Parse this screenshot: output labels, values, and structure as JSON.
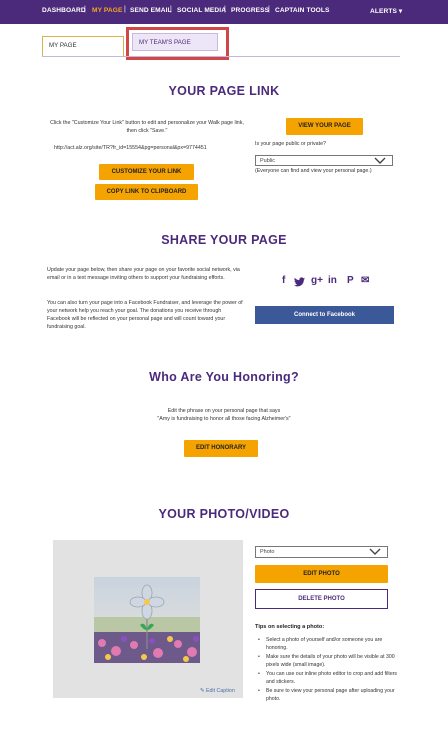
{
  "nav": {
    "items": [
      {
        "label": "DASHBOARD",
        "active": false
      },
      {
        "label": "MY PAGE",
        "active": true
      },
      {
        "label": "SEND EMAIL",
        "active": false
      },
      {
        "label": "SOCIAL MEDIA",
        "active": false
      },
      {
        "label": "PROGRESS",
        "active": false
      },
      {
        "label": "CAPTAIN TOOLS",
        "active": false
      }
    ],
    "alerts_label": "ALERTS",
    "alerts_caret": "▾",
    "separator": "|"
  },
  "tabs": {
    "my_page": "MY PAGE",
    "team_page": "MY TEAM'S PAGE"
  },
  "page_link": {
    "title": "YOUR PAGE LINK",
    "instructions": "Click the \"Customize Your Link\" button to edit and personalize your Walk page link, then click \"Save.\"",
    "url": "http://act.alz.org/site/TR?fr_id=15554&pg=personal&px=9774451",
    "customize_button": "CUSTOMIZE YOUR LINK",
    "copy_button": "COPY LINK TO CLIPBOARD",
    "view_button": "VIEW YOUR PAGE",
    "privacy_question": "Is your page public or private?",
    "privacy_value": "Public",
    "privacy_note": "(Everyone can find and view your personal page.)"
  },
  "share": {
    "title": "SHARE YOUR PAGE",
    "paragraph1": "Update your page below, then share your page on your favorite social network, via email or in a text message inviting others to support your fundraising efforts.",
    "paragraph2": "You can also turn your page into a Facebook Fundraiser, and leverage the power of your network help you reach your goal. The donations you receive through Facebook will be reflected on your personal page and will count toward your fundraising goal.",
    "connect_button": "Connect to Facebook",
    "icons": {
      "facebook": "f",
      "twitter": "t",
      "googleplus": "g+",
      "linkedin": "in",
      "pinterest": "P",
      "email": "✉"
    }
  },
  "honoring": {
    "title": "Who Are You Honoring?",
    "line1": "Edit the phrase on your personal page that says",
    "line2": "\"Amy is fundraising to honor all those facing Alzheimer's\"",
    "edit_button": "EDIT HONORARY"
  },
  "photo_video": {
    "title": "YOUR PHOTO/VIDEO",
    "media_type": "Photo",
    "edit_button": "EDIT PHOTO",
    "delete_button": "DELETE PHOTO",
    "edit_caption": "Edit Caption",
    "tips_title": "Tips on selecting a photo:",
    "tips": [
      "Select a photo of yourself and/or someone you are honoring.",
      "Make sure the details of your photo will be visible at 300 pixels wide (small image).",
      "You can use our inline photo editor to crop and add filters and stickers.",
      "Be sure to view your personal page after uploading your photo."
    ]
  },
  "colors": {
    "brand_purple": "#4b2a7b",
    "accent_orange": "#f5a300",
    "facebook_blue": "#3b5998",
    "highlight_red": "#d14646"
  }
}
